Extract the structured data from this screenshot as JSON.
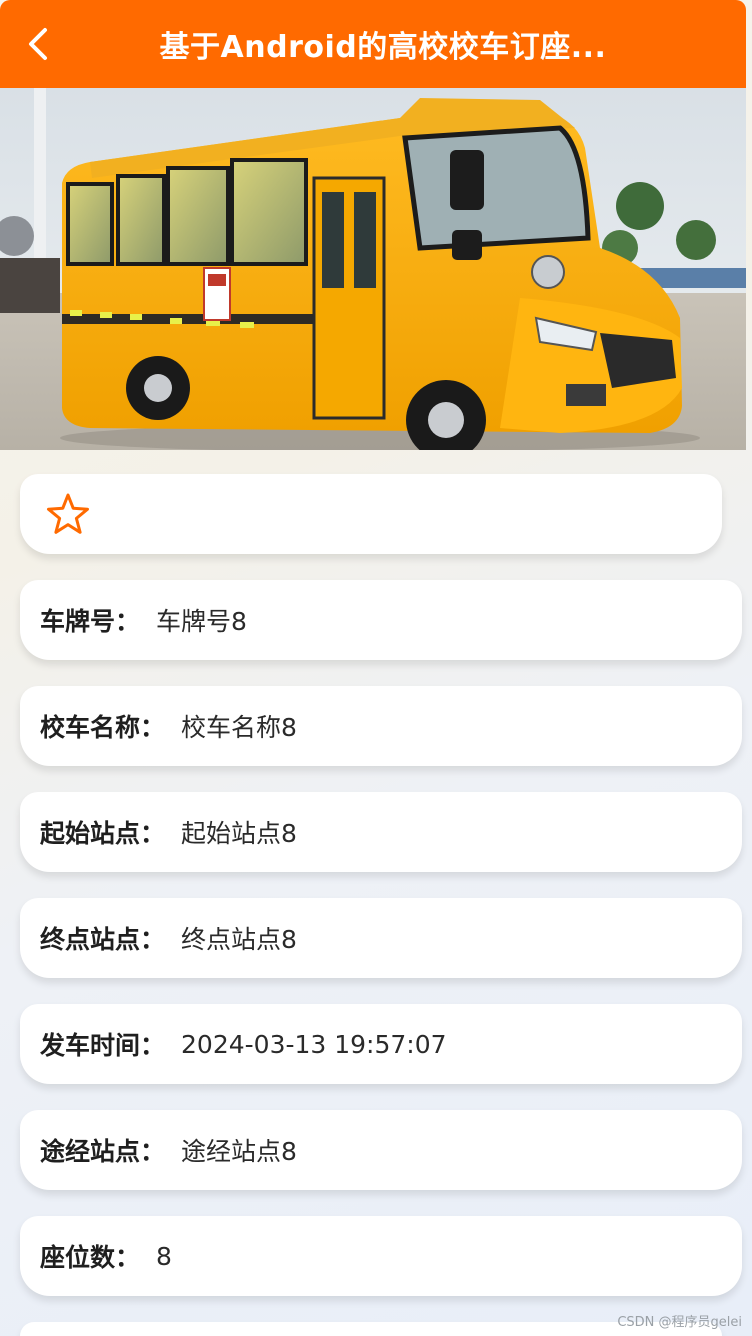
{
  "header": {
    "title": "基于Android的高校校车订座..."
  },
  "icons": {
    "back": "chevron-left-icon",
    "favorite": "star-outline-icon"
  },
  "colors": {
    "accent": "#ff6a00",
    "card": "#ffffff"
  },
  "details": [
    {
      "label": "车牌号：",
      "value": "车牌号8"
    },
    {
      "label": "校车名称：",
      "value": "校车名称8"
    },
    {
      "label": "起始站点：",
      "value": "起始站点8"
    },
    {
      "label": "终点站点：",
      "value": "终点站点8"
    },
    {
      "label": "发车时间：",
      "value": "2024-03-13 19:57:07"
    },
    {
      "label": "途经站点：",
      "value": "途经站点8"
    },
    {
      "label": "座位数：",
      "value": "8"
    }
  ],
  "watermark": "CSDN @程序员gelei"
}
